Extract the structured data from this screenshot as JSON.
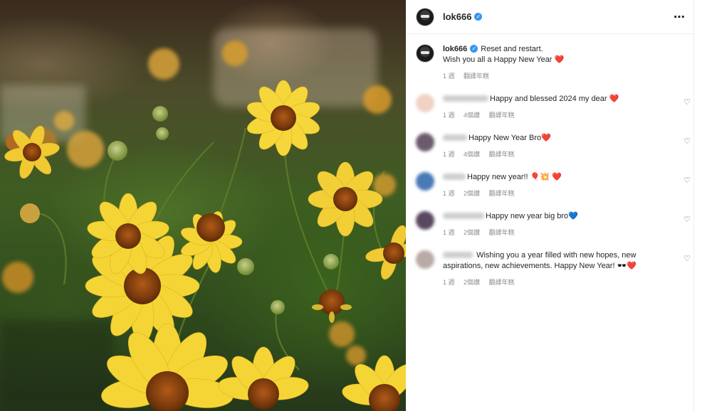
{
  "post": {
    "username": "lok666",
    "verified_mark": "✓",
    "more_icon": "⋯"
  },
  "caption": {
    "username": "lok666",
    "line1": "Reset and restart.",
    "line2": "Wish you all a Happy New Year",
    "emoji": "❤️",
    "time": "1 週",
    "translate": "翻譯年糕"
  },
  "comments": [
    {
      "text": "Happy and blessed 2024 my dear",
      "emoji": "❤️",
      "time": "1 週",
      "likes": "4個讚",
      "translate": "翻譯年糕"
    },
    {
      "text": "Happy New Year Bro",
      "emoji": "❤️",
      "time": "1 週",
      "likes": "4個讚",
      "translate": "翻譯年糕"
    },
    {
      "text": "Happy new year!!",
      "emoji": "🎈💥 ❤️",
      "time": "1 週",
      "likes": "2個讚",
      "translate": "翻譯年糕"
    },
    {
      "text": "Happy new year big bro",
      "emoji": "💙",
      "time": "1 週",
      "likes": "2個讚",
      "translate": "翻譯年糕"
    },
    {
      "text": "Wishing you a year filled with new hopes, new aspirations, new achievements. Happy New Year!",
      "emoji": "🕶️❤️",
      "time": "1 週",
      "likes": "2個讚",
      "translate": "翻譯年糕"
    }
  ],
  "icons": {
    "like": "♡"
  },
  "colors": {
    "heart_red": "#ed2a3c",
    "heart_blue": "#1f6fd1",
    "verified": "#3897f0",
    "meta_gray": "#8e8e8e"
  }
}
